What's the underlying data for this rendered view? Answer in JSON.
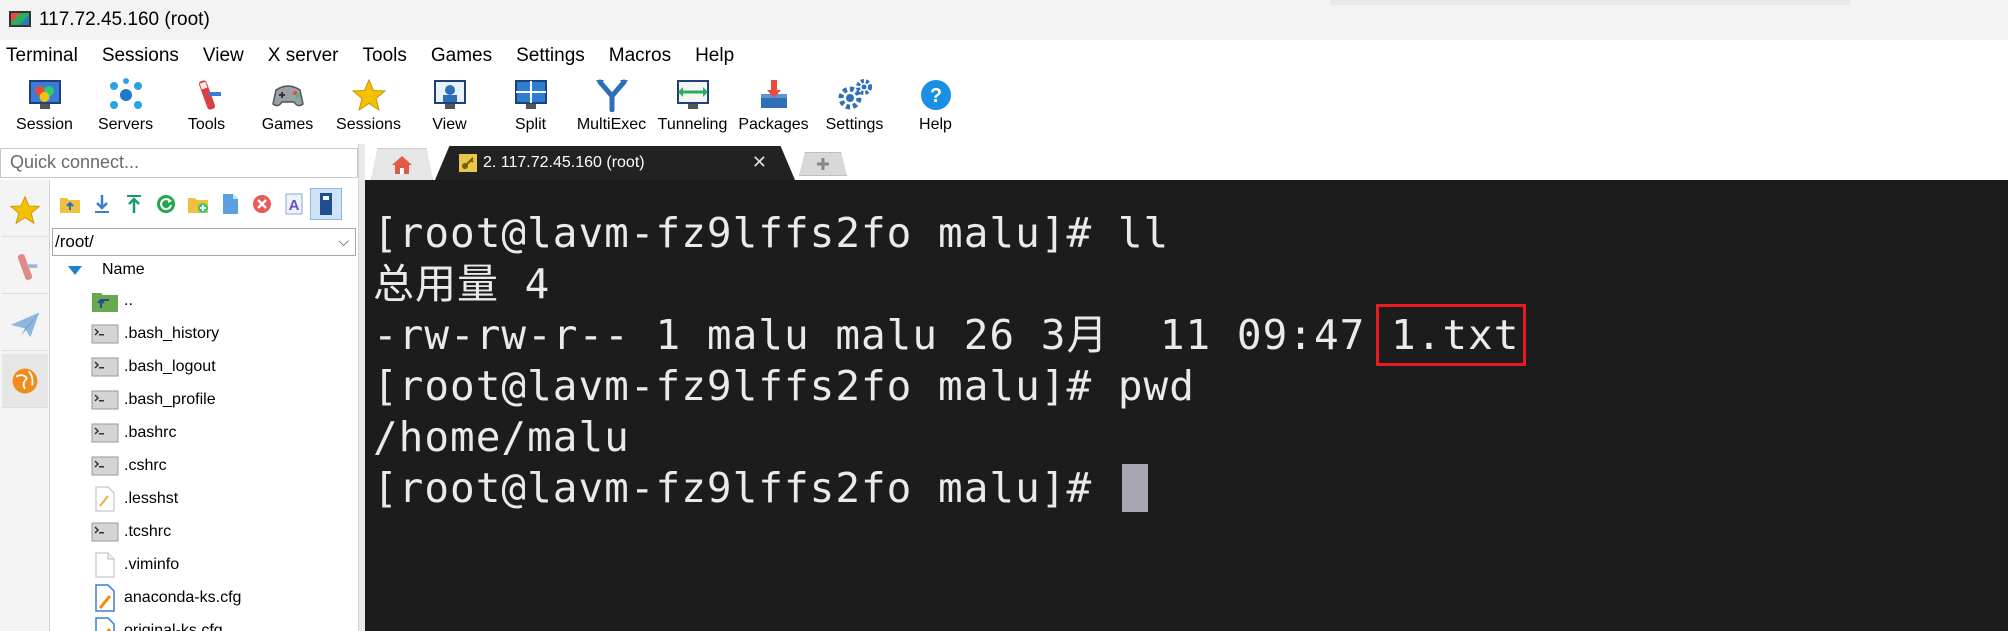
{
  "window": {
    "title": "117.72.45.160 (root)"
  },
  "menu": [
    "Terminal",
    "Sessions",
    "View",
    "X server",
    "Tools",
    "Games",
    "Settings",
    "Macros",
    "Help"
  ],
  "toolbar": [
    {
      "label": "Session",
      "icon": "session-icon"
    },
    {
      "label": "Servers",
      "icon": "servers-icon"
    },
    {
      "label": "Tools",
      "icon": "tools-icon"
    },
    {
      "label": "Games",
      "icon": "games-icon"
    },
    {
      "label": "Sessions",
      "icon": "star-icon"
    },
    {
      "label": "View",
      "icon": "view-icon"
    },
    {
      "label": "Split",
      "icon": "split-icon"
    },
    {
      "label": "MultiExec",
      "icon": "multiexec-icon"
    },
    {
      "label": "Tunneling",
      "icon": "tunneling-icon"
    },
    {
      "label": "Packages",
      "icon": "packages-icon"
    },
    {
      "label": "Settings",
      "icon": "gear-icon"
    },
    {
      "label": "Help",
      "icon": "help-icon"
    }
  ],
  "quick_connect": {
    "placeholder": "Quick connect..."
  },
  "sftp": {
    "path": "/root/",
    "column_name": "Name",
    "files": [
      {
        "name": "..",
        "type": "parent"
      },
      {
        "name": ".bash_history",
        "type": "terminal-file"
      },
      {
        "name": ".bash_logout",
        "type": "terminal-file"
      },
      {
        "name": ".bash_profile",
        "type": "terminal-file"
      },
      {
        "name": ".bashrc",
        "type": "terminal-file"
      },
      {
        "name": ".cshrc",
        "type": "terminal-file"
      },
      {
        "name": ".lesshst",
        "type": "text-file"
      },
      {
        "name": ".tcshrc",
        "type": "terminal-file"
      },
      {
        "name": ".viminfo",
        "type": "blank-file"
      },
      {
        "name": "anaconda-ks.cfg",
        "type": "cfg-file"
      },
      {
        "name": "original-ks.cfg",
        "type": "cfg-file"
      }
    ]
  },
  "tabs": {
    "active": "2. 117.72.45.160 (root)"
  },
  "terminal": {
    "lines": [
      "[root@lavm-fz9lffs2fo malu]# ll",
      "总用量 4",
      "-rw-rw-r-- 1 malu malu 26 3月  11 09:47 1.txt",
      "[root@lavm-fz9lffs2fo malu]# pwd",
      "/home/malu",
      "[root@lavm-fz9lffs2fo malu]# "
    ],
    "highlight_color": "#e81b23",
    "background": "#1c1c1c"
  }
}
